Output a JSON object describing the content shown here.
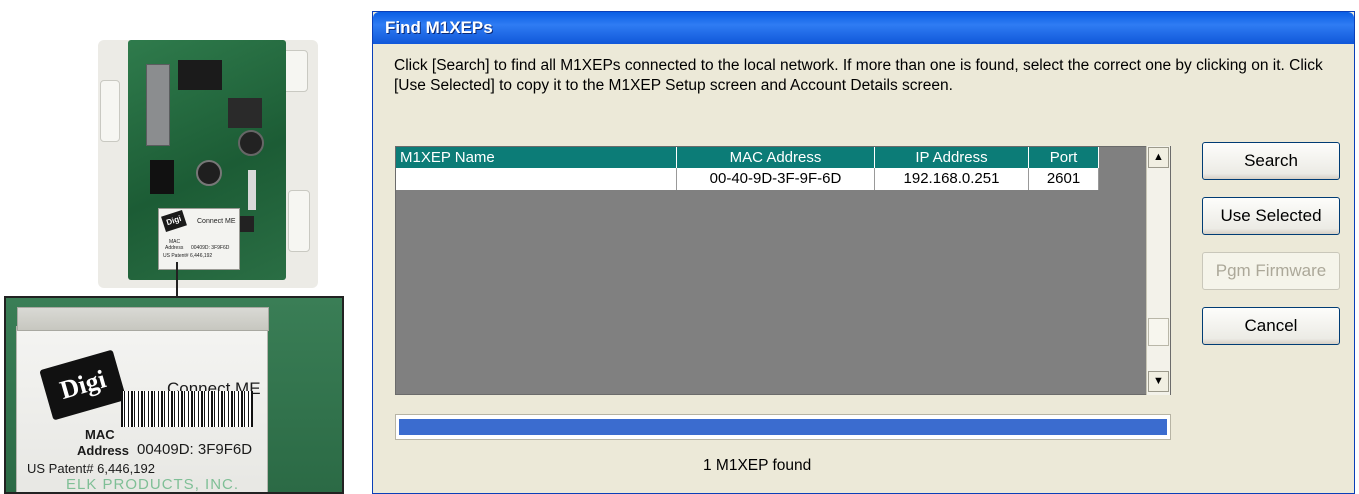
{
  "photo": {
    "module_brand": "Digi",
    "module_model": "Connect ME",
    "mac_label_line1": "MAC",
    "mac_label_line2": "Address",
    "mac_value": "00409D:  3F9F6D",
    "patent": "US Patent# 6,446,192",
    "board_text": "ELK PRODUCTS, INC."
  },
  "dialog": {
    "title": "Find M1XEPs",
    "instructions": "Click [Search] to find all M1XEPs connected to the local network.  If more than one is found, select the correct one by clicking on it.  Click [Use Selected] to copy it to the M1XEP Setup screen and Account Details screen.",
    "table": {
      "columns": [
        "M1XEP Name",
        "MAC Address",
        "IP Address",
        "Port"
      ],
      "rows": [
        {
          "name": "",
          "mac": "00-40-9D-3F-9F-6D",
          "ip": "192.168.0.251",
          "port": "2601"
        }
      ]
    },
    "progress": 1.0,
    "status": "1 M1XEP found",
    "buttons": {
      "search": "Search",
      "use_selected": "Use Selected",
      "pgm_firmware": "Pgm Firmware",
      "cancel": "Cancel"
    }
  },
  "colors": {
    "title_bar": "#0a5ee4",
    "grid_header": "#0c7c77",
    "grid_background": "#808080",
    "progress_fill": "#3b6ccf",
    "dialog_face": "#ece9d8"
  },
  "icons": {
    "scroll_up": "up-arrow-icon",
    "scroll_down": "down-arrow-icon"
  }
}
